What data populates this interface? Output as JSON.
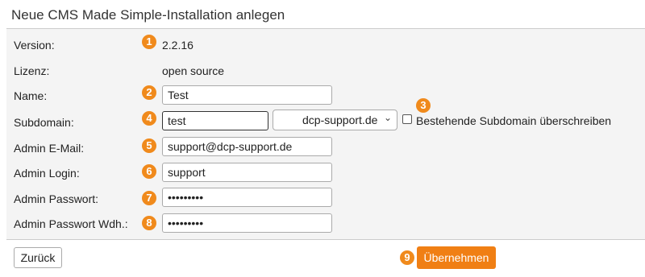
{
  "title": "Neue CMS Made Simple-Installation anlegen",
  "labels": {
    "version": "Version:",
    "license": "Lizenz:",
    "name": "Name:",
    "subdomain": "Subdomain:",
    "admin_email": "Admin E-Mail:",
    "admin_login": "Admin Login:",
    "admin_password": "Admin Passwort:",
    "admin_password_repeat": "Admin Passwort Wdh.:"
  },
  "values": {
    "version": "2.2.16",
    "license": "open source",
    "name": "Test",
    "subdomain": "test",
    "domain": "dcp-support.de",
    "admin_email": "support@dcp-support.de",
    "admin_login": "support",
    "admin_password": "•••••••••",
    "admin_password_repeat": "•••••••••"
  },
  "overwrite_checkbox": {
    "label": "Bestehende Subdomain überschreiben",
    "checked": false
  },
  "badges": [
    "1",
    "2",
    "3",
    "4",
    "5",
    "6",
    "7",
    "8",
    "9"
  ],
  "buttons": {
    "back": "Zurück",
    "apply": "Übernehmen"
  },
  "colors": {
    "accent": "#f07f14",
    "badge": "#f08a1c"
  }
}
